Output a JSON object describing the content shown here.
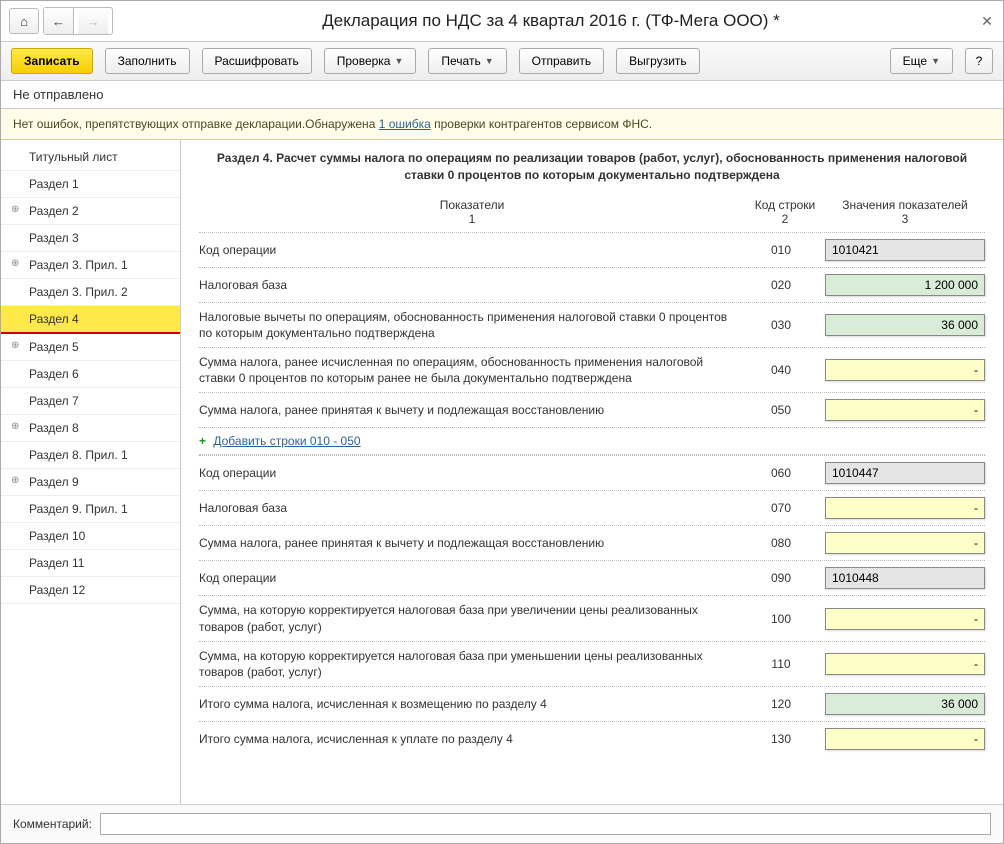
{
  "header": {
    "title": "Декларация по НДС за 4 квартал 2016 г. (ТФ-Мега ООО) *"
  },
  "toolbar": {
    "save": "Записать",
    "fill": "Заполнить",
    "decode": "Расшифровать",
    "check": "Проверка",
    "print": "Печать",
    "send": "Отправить",
    "export": "Выгрузить",
    "more": "Еще",
    "help": "?"
  },
  "status": "Не отправлено",
  "info_bar": {
    "prefix": "Нет ошибок, препятствующих отправке декларации.Обнаружена ",
    "link": "1 ошибка",
    "suffix": " проверки контрагентов сервисом ФНС."
  },
  "sidebar": [
    {
      "label": "Титульный лист",
      "expandable": false
    },
    {
      "label": "Раздел 1",
      "expandable": false
    },
    {
      "label": "Раздел 2",
      "expandable": true
    },
    {
      "label": "Раздел 3",
      "expandable": false
    },
    {
      "label": "Раздел 3. Прил. 1",
      "expandable": true
    },
    {
      "label": "Раздел 3. Прил. 2",
      "expandable": false
    },
    {
      "label": "Раздел 4",
      "expandable": false,
      "active": true
    },
    {
      "label": "Раздел 5",
      "expandable": true
    },
    {
      "label": "Раздел 6",
      "expandable": false
    },
    {
      "label": "Раздел 7",
      "expandable": false
    },
    {
      "label": "Раздел 8",
      "expandable": true
    },
    {
      "label": "Раздел 8. Прил. 1",
      "expandable": false
    },
    {
      "label": "Раздел 9",
      "expandable": true
    },
    {
      "label": "Раздел 9. Прил. 1",
      "expandable": false
    },
    {
      "label": "Раздел 10",
      "expandable": false
    },
    {
      "label": "Раздел 11",
      "expandable": false
    },
    {
      "label": "Раздел 12",
      "expandable": false
    }
  ],
  "section": {
    "title": "Раздел 4. Расчет суммы налога по операциям по реализации товаров (работ, услуг), обоснованность применения налоговой ставки 0 процентов по которым документально подтверждена",
    "col_headers": {
      "c1a": "Показатели",
      "c1b": "1",
      "c2a": "Код строки",
      "c2b": "2",
      "c3a": "Значения показателей",
      "c3b": "3"
    },
    "rows_a": [
      {
        "label": "Код операции",
        "code": "010",
        "style": "gray",
        "value": "1010421",
        "align": "left"
      },
      {
        "label": "Налоговая база",
        "code": "020",
        "style": "green",
        "value": "1 200 000"
      },
      {
        "label": "Налоговые вычеты по операциям, обоснованность применения налоговой ставки 0 процентов по которым документально подтверждена",
        "code": "030",
        "style": "green",
        "value": "36 000"
      },
      {
        "label": "Сумма налога, ранее исчисленная по операциям, обоснованность применения налоговой ставки 0 процентов по которым ранее не была документально подтверждена",
        "code": "040",
        "style": "yellow",
        "value": "-"
      },
      {
        "label": "Сумма налога, ранее принятая к вычету и подлежащая восстановлению",
        "code": "050",
        "style": "yellow",
        "value": "-"
      }
    ],
    "add_link": "Добавить строки 010 - 050",
    "rows_b": [
      {
        "label": "Код операции",
        "code": "060",
        "style": "gray",
        "value": "1010447",
        "align": "left"
      },
      {
        "label": "Налоговая база",
        "code": "070",
        "style": "yellow",
        "value": "-"
      },
      {
        "label": "Сумма налога, ранее принятая к вычету и подлежащая восстановлению",
        "code": "080",
        "style": "yellow",
        "value": "-"
      },
      {
        "label": "Код операции",
        "code": "090",
        "style": "gray",
        "value": "1010448",
        "align": "left"
      },
      {
        "label": "Сумма, на которую корректируется налоговая база при увеличении цены реализованных товаров (работ, услуг)",
        "code": "100",
        "style": "yellow",
        "value": "-"
      },
      {
        "label": "Сумма, на которую корректируется налоговая база при уменьшении цены реализованных товаров (работ, услуг)",
        "code": "110",
        "style": "yellow",
        "value": "-"
      },
      {
        "label": "Итого сумма налога, исчисленная к возмещению по разделу 4",
        "code": "120",
        "style": "green",
        "value": "36 000"
      },
      {
        "label": "Итого сумма налога, исчисленная к уплате по разделу 4",
        "code": "130",
        "style": "yellow",
        "value": "-"
      }
    ]
  },
  "footer": {
    "label": "Комментарий:",
    "value": ""
  }
}
